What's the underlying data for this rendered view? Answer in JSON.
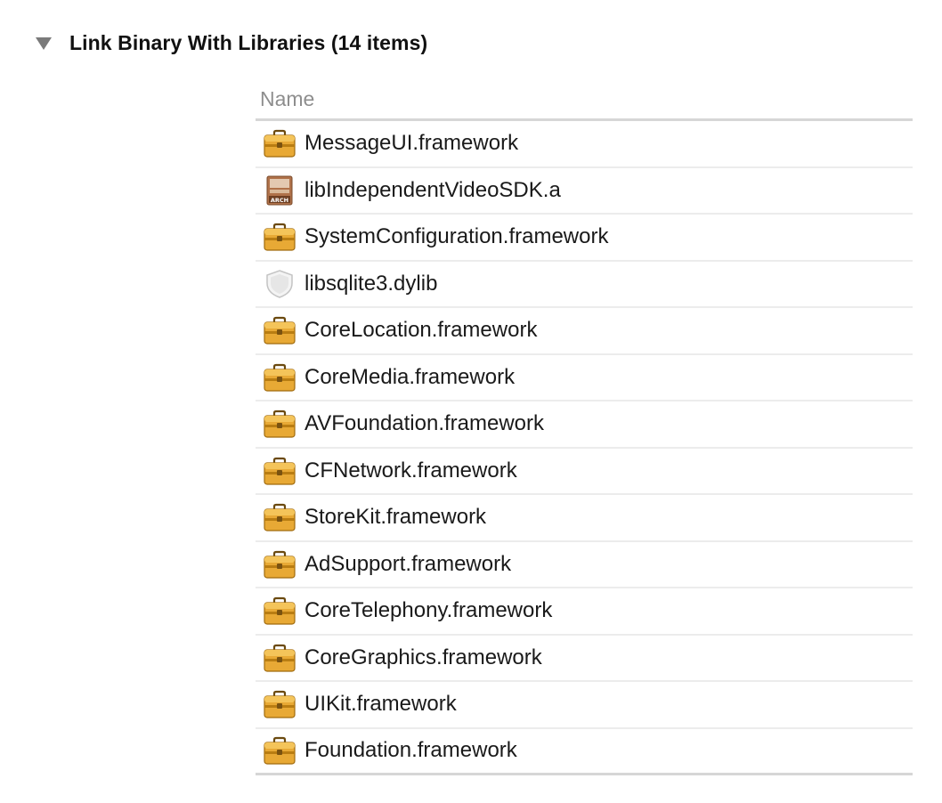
{
  "section": {
    "title": "Link Binary With Libraries (14 items)"
  },
  "table": {
    "column_header": "Name",
    "rows": [
      {
        "name": "MessageUI.framework",
        "icon": "framework-toolbox-icon"
      },
      {
        "name": "libIndependentVideoSDK.a",
        "icon": "static-library-icon",
        "icon_text": "ARCH"
      },
      {
        "name": "SystemConfiguration.framework",
        "icon": "framework-toolbox-icon"
      },
      {
        "name": "libsqlite3.dylib",
        "icon": "dylib-shield-icon"
      },
      {
        "name": "CoreLocation.framework",
        "icon": "framework-toolbox-icon"
      },
      {
        "name": "CoreMedia.framework",
        "icon": "framework-toolbox-icon"
      },
      {
        "name": "AVFoundation.framework",
        "icon": "framework-toolbox-icon"
      },
      {
        "name": "CFNetwork.framework",
        "icon": "framework-toolbox-icon"
      },
      {
        "name": "StoreKit.framework",
        "icon": "framework-toolbox-icon"
      },
      {
        "name": "AdSupport.framework",
        "icon": "framework-toolbox-icon"
      },
      {
        "name": "CoreTelephony.framework",
        "icon": "framework-toolbox-icon"
      },
      {
        "name": "CoreGraphics.framework",
        "icon": "framework-toolbox-icon"
      },
      {
        "name": "UIKit.framework",
        "icon": "framework-toolbox-icon"
      },
      {
        "name": "Foundation.framework",
        "icon": "framework-toolbox-icon"
      }
    ]
  },
  "colors": {
    "toolbox_body": "#e8a935",
    "toolbox_dark": "#b97d12",
    "library_body": "#b0724a",
    "dylib_shield": "#d8d8d8"
  }
}
